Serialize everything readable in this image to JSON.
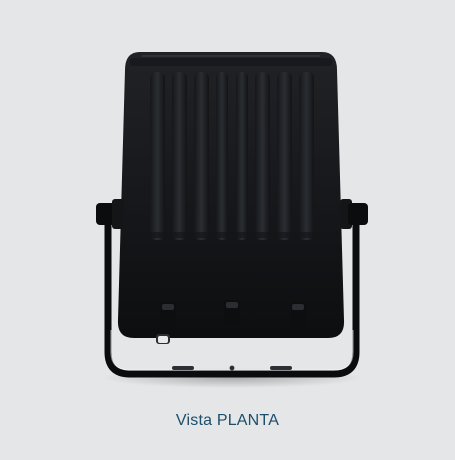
{
  "caption": {
    "text": "Vista PLANTA"
  },
  "image": {
    "subject_icon": "floodlight-back-view-icon",
    "colors": {
      "background": "#e4e6e7",
      "housing": "#111214",
      "fins": "#1d1f22",
      "bracket": "#0b0c0d",
      "caption_text": "#1d4e6b"
    }
  }
}
